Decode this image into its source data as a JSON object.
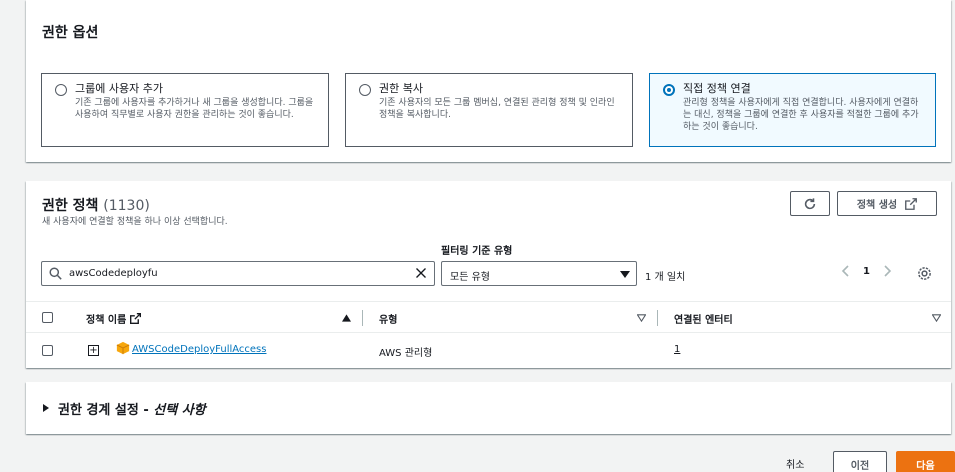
{
  "options": {
    "title": "권한 옵션",
    "cards": [
      {
        "title": "그룹에 사용자 추가",
        "desc": "기존 그룹에 사용자를 추가하거나 새 그룹을 생성합니다. 그룹을 사용하여 직무별로 사용자 권한을 관리하는 것이 좋습니다.",
        "selected": false
      },
      {
        "title": "권한 복사",
        "desc": "기존 사용자의 모든 그룹 멤버십, 연결된 관리형 정책 및 인라인 정책을 복사합니다.",
        "selected": false
      },
      {
        "title": "직접 정책 연결",
        "desc": "관리형 정책을 사용자에게 직접 연결합니다. 사용자에게 연결하는 대신, 정책을 그룹에 연결한 후 사용자를 적절한 그룹에 추가하는 것이 좋습니다.",
        "selected": true
      }
    ]
  },
  "policies": {
    "title": "권한 정책",
    "count": "(1130)",
    "description": "새 사용자에 연결할 정책을 하나 이상 선택합니다.",
    "create_label": "정책 생성",
    "filter_label": "필터링 기준 유형",
    "search_value": "awsCodedeployfu",
    "filter_value": "모든 유형",
    "match_text": "1 개 일치",
    "page": "1",
    "columns": {
      "name": "정책 이름",
      "type": "유형",
      "entities": "연결된 엔터티"
    },
    "rows": [
      {
        "name": "AWSCodeDeployFullAccess",
        "type": "AWS 관리형",
        "entities": "1"
      }
    ]
  },
  "boundary": {
    "title": "권한 경계 설정 - ",
    "optional": "선택 사항"
  },
  "footer": {
    "cancel": "취소",
    "prev": "이전",
    "next": "다음"
  },
  "colors": {
    "accent": "#0073bb",
    "primary_button": "#ec7211",
    "aws_cube": "#f7a70c"
  }
}
